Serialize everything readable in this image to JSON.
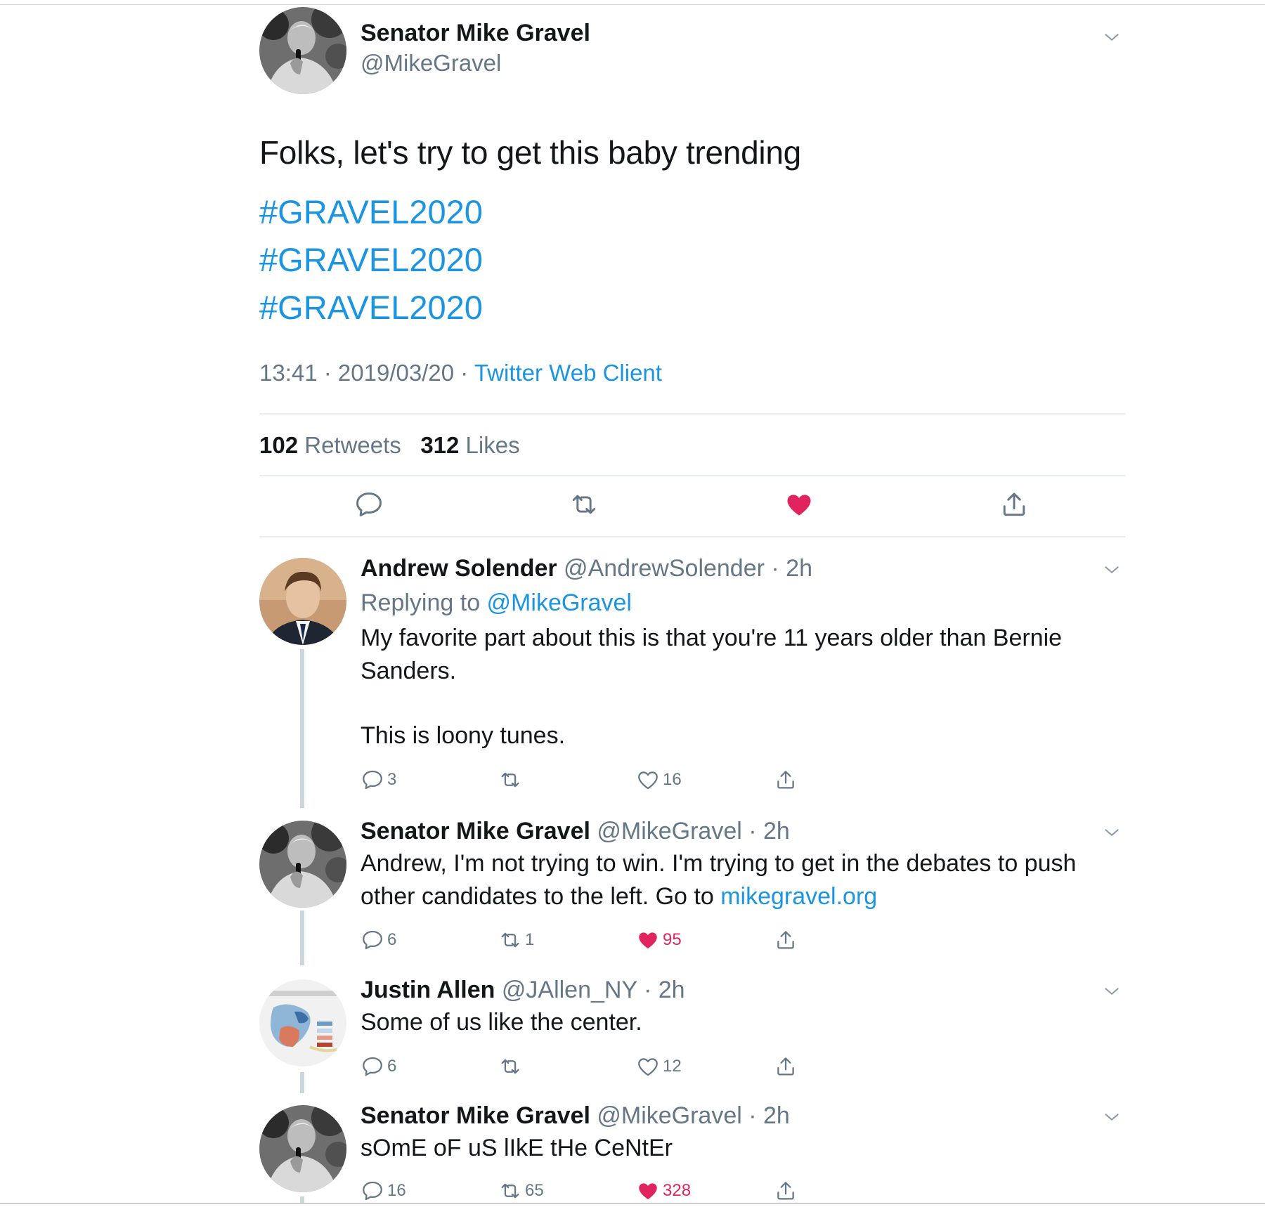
{
  "main_tweet": {
    "author_name": "Senator Mike Gravel",
    "handle": "@MikeGravel",
    "text": "Folks, let's try to get this baby trending",
    "hashtags": [
      "#GRAVEL2020",
      "#GRAVEL2020",
      "#GRAVEL2020"
    ],
    "time": "13:41 · 2019/03/20 · ",
    "client": "Twitter Web Client",
    "retweet_count": "102",
    "retweet_label": " Retweets",
    "like_count": "312",
    "like_label": " Likes",
    "liked": true
  },
  "replies": [
    {
      "author_name": "Andrew Solender",
      "handle": " @AndrewSolender · 2h",
      "replying_prefix": "Replying to ",
      "replying_to": "@MikeGravel",
      "text_lines": [
        "My favorite part about this is that you're 11 years older than Bernie",
        "Sanders.",
        "This is loony tunes."
      ],
      "replies": "3",
      "retweets": "",
      "likes": "16",
      "liked": false
    },
    {
      "author_name": "Senator Mike Gravel",
      "handle": " @MikeGravel · 2h",
      "text_lines": [
        "Andrew, I'm not trying to win. I'm trying to get in the debates to push",
        "other candidates to the left. Go to "
      ],
      "link": "mikegravel.org",
      "replies": "6",
      "retweets": "1",
      "likes": "95",
      "liked": true
    },
    {
      "author_name": "Justin Allen",
      "handle": " @JAllen_NY · 2h",
      "text_lines": [
        "Some of us like the center."
      ],
      "replies": "6",
      "retweets": "",
      "likes": "12",
      "liked": false
    },
    {
      "author_name": "Senator Mike Gravel",
      "handle": " @MikeGravel · 2h",
      "text_lines": [
        "sOmE oF uS lIkE tHe CeNtEr"
      ],
      "replies": "16",
      "retweets": "65",
      "likes": "328",
      "liked": true
    }
  ],
  "icons": [
    "reply-icon",
    "retweet-icon",
    "like-icon",
    "share-icon",
    "chevron-down-icon"
  ],
  "colors": {
    "link": "#1b95e0",
    "like": "#e0245e",
    "secondary_text": "#657786"
  }
}
